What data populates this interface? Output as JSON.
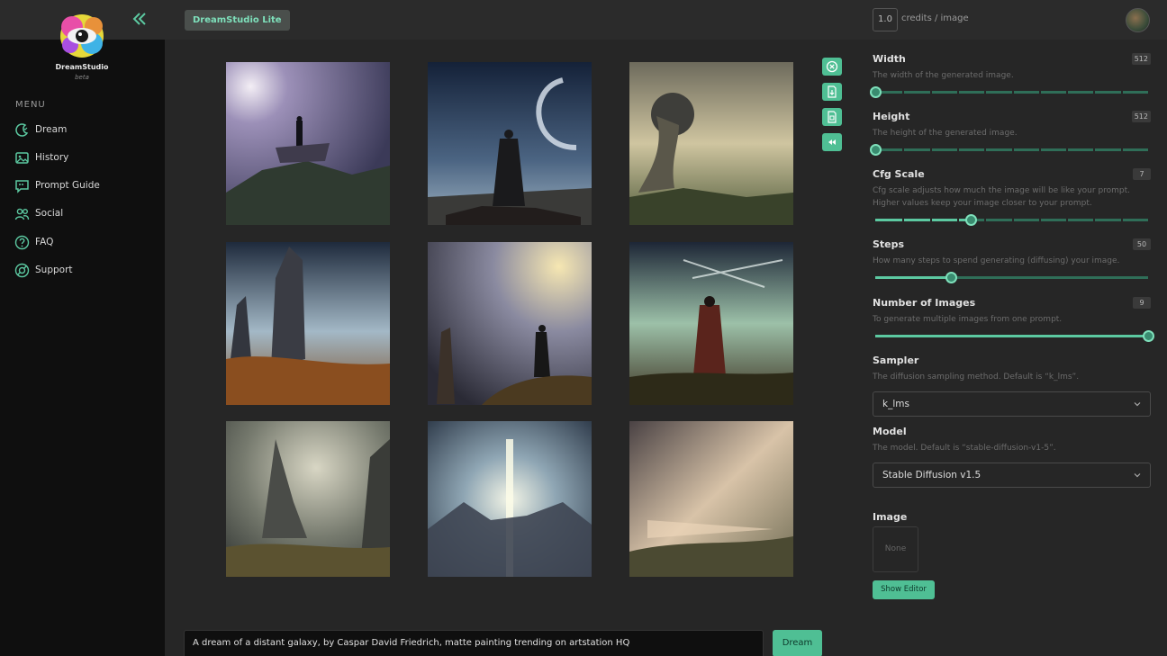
{
  "app": {
    "brand": "DreamStudio",
    "brand_sub": "beta",
    "badge": "DreamStudio Lite",
    "credits_value": "1.0",
    "credits_label": "credits / image"
  },
  "sidebar": {
    "menu_title": "MENU",
    "items": [
      {
        "label": "Dream",
        "icon": "dream-icon"
      },
      {
        "label": "History",
        "icon": "history-icon"
      },
      {
        "label": "Prompt Guide",
        "icon": "prompt-guide-icon"
      },
      {
        "label": "Social",
        "icon": "social-icon"
      },
      {
        "label": "FAQ",
        "icon": "faq-icon"
      },
      {
        "label": "Support",
        "icon": "support-icon"
      }
    ]
  },
  "main": {
    "prompt": "A dream of a distant galaxy, by Caspar David Friedrich, matte painting trending on artstation HQ",
    "dream_button": "Dream",
    "actions": [
      "clear-icon",
      "download-icon",
      "save-icon",
      "rewind-icon"
    ]
  },
  "settings": {
    "width": {
      "label": "Width",
      "value": "512",
      "desc": "The width of the generated image.",
      "fraction": 0.0
    },
    "height": {
      "label": "Height",
      "value": "512",
      "desc": "The height of the generated image.",
      "fraction": 0.0
    },
    "cfg": {
      "label": "Cfg Scale",
      "value": "7",
      "desc1": "Cfg scale adjusts how much the image will be like your prompt.",
      "desc2": "Higher values keep your image closer to your prompt.",
      "fraction": 0.35
    },
    "steps": {
      "label": "Steps",
      "value": "50",
      "desc": "How many steps to spend generating (diffusing) your image.",
      "fraction": 0.28
    },
    "num_images": {
      "label": "Number of Images",
      "value": "9",
      "desc": "To generate multiple images from one prompt.",
      "fraction": 1.0
    },
    "sampler": {
      "label": "Sampler",
      "desc": "The diffusion sampling method. Default is “k_lms”.",
      "selected": "k_lms"
    },
    "model": {
      "label": "Model",
      "desc": "The model. Default is “stable-diffusion-v1-5”.",
      "selected": "Stable Diffusion v1.5"
    },
    "image": {
      "label": "Image",
      "value": "None",
      "editor_button": "Show Editor"
    }
  },
  "colors": {
    "accent": "#5cc9a1",
    "accent_dark": "#2f6e58"
  }
}
